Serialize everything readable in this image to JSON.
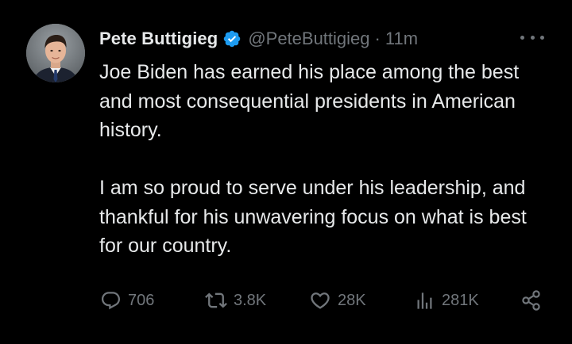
{
  "tweet": {
    "author": {
      "display_name": "Pete Buttigieg",
      "handle": "@PeteButtigieg",
      "verified": true,
      "avatar_icon": "profile-photo"
    },
    "separator": "·",
    "time": "11m",
    "paragraphs": [
      "Joe Biden has earned his place among the best and most consequential presidents in American history.",
      "I am so proud to serve under his leadership, and thankful for his unwavering focus on what is best for our country."
    ]
  },
  "actions": {
    "replies": "706",
    "reposts": "3.8K",
    "likes": "28K",
    "views": "281K"
  },
  "icons": {
    "verified": "verified-badge-icon",
    "more": "more-icon",
    "reply": "reply-icon",
    "repost": "repost-icon",
    "like": "like-icon",
    "views": "views-icon",
    "share": "share-icon"
  },
  "colors": {
    "background": "#000000",
    "primary_text": "#e7e9ea",
    "secondary_text": "#71767b",
    "verified_badge": "#1d9bf0"
  }
}
